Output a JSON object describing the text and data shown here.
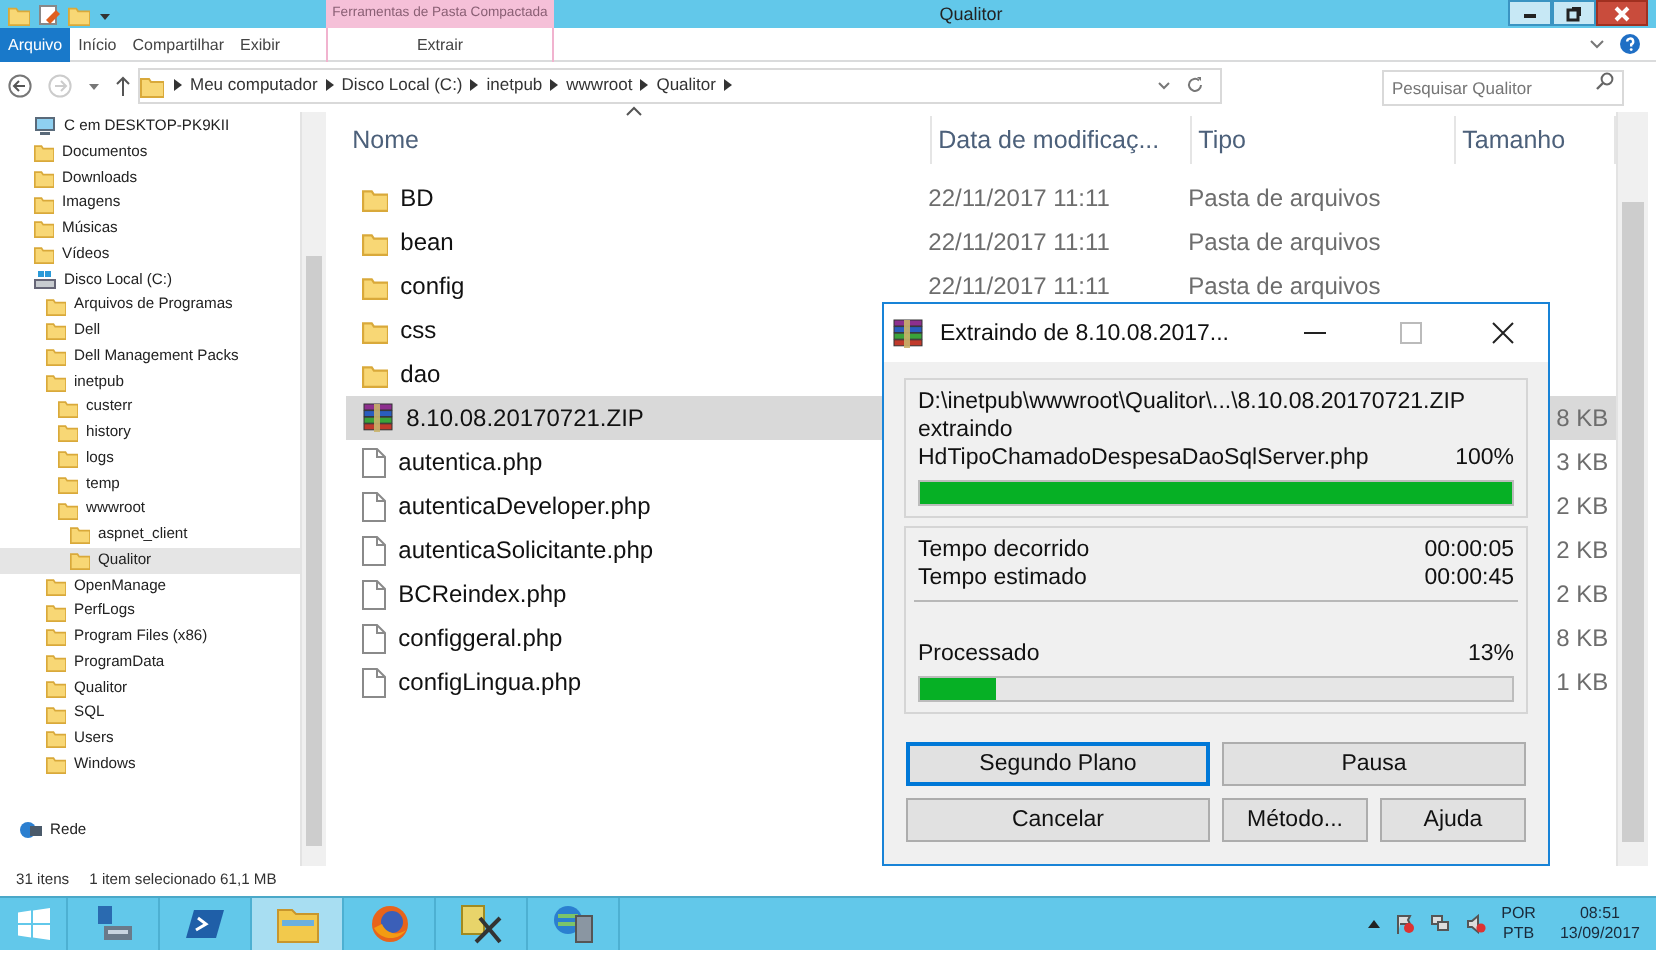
{
  "window": {
    "title": "Qualitor",
    "context_group": "Ferramentas de Pasta Compactada"
  },
  "ribbon_tabs": [
    {
      "label": "Arquivo",
      "selected": true,
      "kind": "file"
    },
    {
      "label": "Início",
      "selected": false,
      "kind": "plain"
    },
    {
      "label": "Compartilhar",
      "selected": false,
      "kind": "plain"
    },
    {
      "label": "Exibir",
      "selected": false,
      "kind": "plain"
    },
    {
      "label": "Extrair",
      "selected": false,
      "kind": "contextual"
    }
  ],
  "address": {
    "breadcrumb": [
      "Meu computador",
      "Disco Local (C:)",
      "inetpub",
      "wwwroot",
      "Qualitor"
    ],
    "search_placeholder": "Pesquisar Qualitor"
  },
  "sidebar": {
    "items": [
      {
        "label": "C em DESKTOP-PK9KII",
        "kind": "computer",
        "selected": false
      },
      {
        "label": "Documentos",
        "kind": "folder",
        "selected": false
      },
      {
        "label": "Downloads",
        "kind": "folder",
        "selected": false
      },
      {
        "label": "Imagens",
        "kind": "folder",
        "selected": false
      },
      {
        "label": "Músicas",
        "kind": "folder",
        "selected": false
      },
      {
        "label": "Vídeos",
        "kind": "folder",
        "selected": false
      },
      {
        "label": "Disco Local (C:)",
        "kind": "drive",
        "selected": false,
        "children": [
          {
            "label": "Arquivos de Programas",
            "kind": "folder",
            "selected": false
          },
          {
            "label": "Dell",
            "kind": "folder",
            "selected": false
          },
          {
            "label": "Dell Management Packs",
            "kind": "folder",
            "selected": false
          },
          {
            "label": "inetpub",
            "kind": "folder",
            "selected": false,
            "children": [
              {
                "label": "custerr",
                "kind": "folder",
                "selected": false
              },
              {
                "label": "history",
                "kind": "folder",
                "selected": false
              },
              {
                "label": "logs",
                "kind": "folder",
                "selected": false
              },
              {
                "label": "temp",
                "kind": "folder",
                "selected": false
              },
              {
                "label": "wwwroot",
                "kind": "folder",
                "selected": false,
                "children": [
                  {
                    "label": "aspnet_client",
                    "kind": "folder",
                    "selected": false
                  },
                  {
                    "label": "Qualitor",
                    "kind": "folder",
                    "selected": true
                  }
                ]
              }
            ]
          },
          {
            "label": "OpenManage",
            "kind": "folder",
            "selected": false
          },
          {
            "label": "PerfLogs",
            "kind": "folder",
            "selected": false
          },
          {
            "label": "Program Files (x86)",
            "kind": "folder",
            "selected": false
          },
          {
            "label": "ProgramData",
            "kind": "folder",
            "selected": false
          },
          {
            "label": "Qualitor",
            "kind": "folder",
            "selected": false
          },
          {
            "label": "SQL",
            "kind": "folder",
            "selected": false
          },
          {
            "label": "Users",
            "kind": "folder",
            "selected": false
          },
          {
            "label": "Windows",
            "kind": "folder",
            "selected": false
          }
        ]
      }
    ],
    "network": {
      "label": "Rede"
    }
  },
  "columns": [
    "Nome",
    "Data de modificaç...",
    "Tipo",
    "Tamanho"
  ],
  "files": [
    {
      "name": "BD",
      "kind": "folder",
      "date": "22/11/2017 11:11",
      "type": "Pasta de arquivos",
      "selected": false
    },
    {
      "name": "bean",
      "kind": "folder",
      "date": "22/11/2017 11:11",
      "type": "Pasta de arquivos",
      "selected": false
    },
    {
      "name": "config",
      "kind": "folder",
      "date": "22/11/2017 11:11",
      "type": "Pasta de arquivos",
      "selected": false
    },
    {
      "name": "css",
      "kind": "folder",
      "selected": false
    },
    {
      "name": "dao",
      "kind": "folder",
      "selected": false
    },
    {
      "name": "8.10.08.20170721.ZIP",
      "kind": "archive",
      "size": "8 KB",
      "selected": true
    },
    {
      "name": "autentica.php",
      "kind": "file",
      "size": "3 KB",
      "selected": false
    },
    {
      "name": "autenticaDeveloper.php",
      "kind": "file",
      "size": "2 KB",
      "selected": false
    },
    {
      "name": "autenticaSolicitante.php",
      "kind": "file",
      "size": "2 KB",
      "selected": false
    },
    {
      "name": "BCReindex.php",
      "kind": "file",
      "size": "2 KB",
      "selected": false
    },
    {
      "name": "configgeral.php",
      "kind": "file",
      "size": "8 KB",
      "selected": false
    },
    {
      "name": "configLingua.php",
      "kind": "file",
      "size": "1 KB",
      "selected": false
    }
  ],
  "status_bar": {
    "count": "31 itens",
    "selection": "1 item selecionado  61,1 MB"
  },
  "dialog": {
    "title": "Extraindo de 8.10.08.2017...",
    "path": "D:\\inetpub\\wwwroot\\Qualitor\\...\\8.10.08.20170721.ZIP",
    "action": "extraindo",
    "current_file": "HdTipoChamadoDespesaDaoSqlServer.php",
    "file_percent": "100%",
    "file_progress": {
      "level": 1
    },
    "elapsed_label": "Tempo decorrido",
    "elapsed": "00:00:05",
    "estimated_label": "Tempo estimado",
    "estimated": "00:00:45",
    "processed_label": "Processado",
    "processed_percent": "13%",
    "processed_progress": {
      "level": 0.13
    },
    "buttons": [
      {
        "label": "Segundo Plano",
        "focused": true,
        "kind": "wide"
      },
      {
        "label": "Pausa",
        "focused": false,
        "kind": "wide"
      },
      {
        "label": "Cancelar",
        "focused": false,
        "kind": "wide"
      },
      {
        "label": "Método...",
        "focused": false,
        "kind": "narrow"
      },
      {
        "label": "Ajuda",
        "focused": false,
        "kind": "narrow"
      }
    ]
  },
  "taskbar": {
    "apps": [
      {
        "kind": "server",
        "active": false
      },
      {
        "kind": "shell",
        "active": false
      },
      {
        "kind": "explorer",
        "active": true
      },
      {
        "kind": "browser",
        "active": false
      },
      {
        "kind": "tools",
        "active": false
      },
      {
        "kind": "network",
        "active": false
      }
    ],
    "language": [
      "POR",
      "PTB"
    ],
    "time": "08:51",
    "date": "13/09/2017"
  }
}
